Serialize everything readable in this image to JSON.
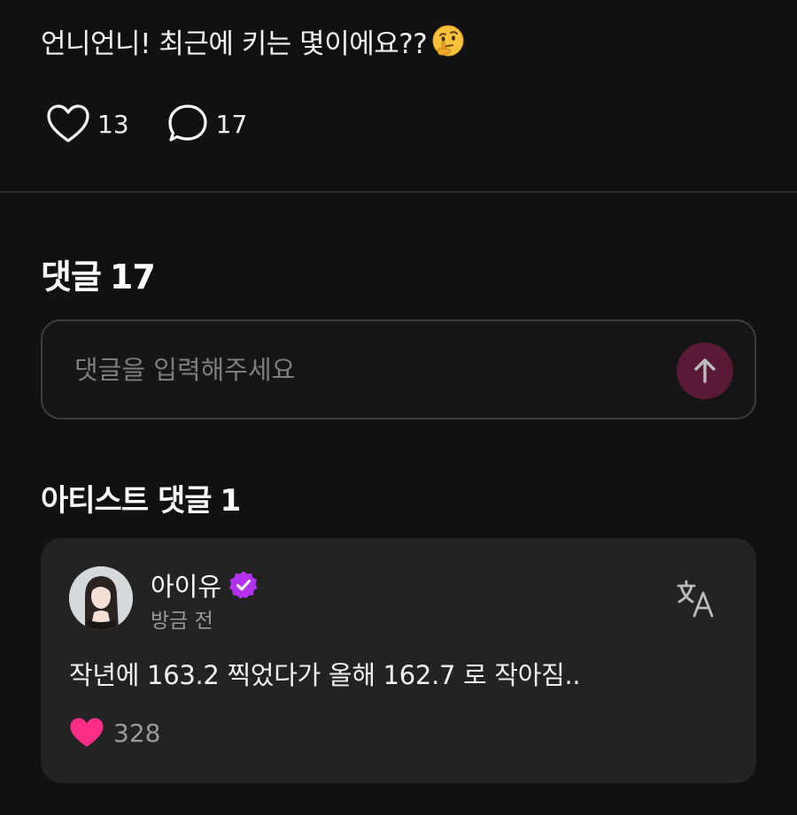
{
  "post": {
    "text": "언니언니! 최근에 키는 몇이에요??",
    "emoji": "thinking-face-emoji",
    "like_count": "13",
    "comment_count": "17"
  },
  "comments": {
    "heading": "댓글",
    "count": "17",
    "input_placeholder": "댓글을 입력해주세요",
    "send_icon": "arrow-up-icon"
  },
  "artist_comments": {
    "heading": "아티스트 댓글",
    "count": "1",
    "items": [
      {
        "author": "아이유",
        "verified": true,
        "time": "방금 전",
        "text": "작년에 163.2 찍었다가 올해 162.7 로 작아짐..",
        "likes": "328",
        "translate_icon": "translate-icon"
      }
    ]
  },
  "colors": {
    "background": "#111111",
    "card": "#232323",
    "accent_pink": "#ff2d8a",
    "verified_purple": "#b431f0",
    "send_button": "#5a1a35"
  }
}
